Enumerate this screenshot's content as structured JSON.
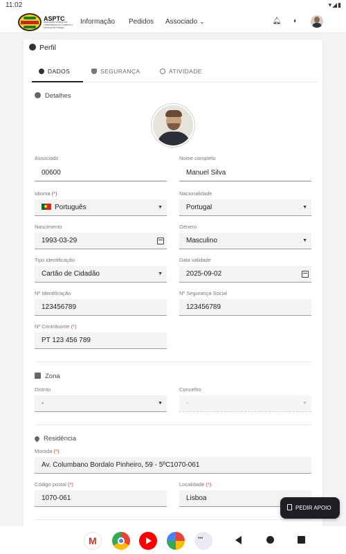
{
  "status_bar": {
    "time": "11:02"
  },
  "app_bar": {
    "brand": {
      "name": "ASPTC",
      "subtitle": "Associação Sindical dos Trabalhadores do Comércio e Serviços de Portugal"
    },
    "nav": [
      {
        "label": "Informação"
      },
      {
        "label": "Pedidos"
      },
      {
        "label": "Associado"
      }
    ]
  },
  "card": {
    "title": "Perfil",
    "tabs": [
      {
        "label": "DADOS",
        "active": true
      },
      {
        "label": "SEGURANÇA",
        "active": false
      },
      {
        "label": "ATIVIDADE",
        "active": false
      }
    ],
    "sections": {
      "detalhes": "Detalhes",
      "zona": "Zona",
      "residencia": "Residência"
    },
    "fields": {
      "associado": {
        "label": "Associado",
        "value": "00600"
      },
      "nome": {
        "label": "Nome completo",
        "value": "Manuel Silva"
      },
      "idioma": {
        "label": "Idioma",
        "required": "(*)",
        "value": "Português"
      },
      "nacionalidade": {
        "label": "Nacionalidade",
        "value": "Portugal"
      },
      "nascimento": {
        "label": "Nascimento",
        "value": "1993-03-29"
      },
      "genero": {
        "label": "Género",
        "value": "Masculino"
      },
      "tipo_id": {
        "label": "Tipo identificação",
        "value": "Cartão de Cidadão"
      },
      "validade": {
        "label": "Data validade",
        "value": "2025-09-02"
      },
      "num_id": {
        "label": "Nº Identificação",
        "value": "123456789"
      },
      "seg_social": {
        "label": "Nº Segurança Social",
        "value": "123456789"
      },
      "contribuinte": {
        "label": "Nº Contribuinte",
        "required": "(*)",
        "value": "PT 123 456 789"
      },
      "distrito": {
        "label": "Distrito",
        "value": "-"
      },
      "concelho": {
        "label": "Concelho",
        "value": "-"
      },
      "morada": {
        "label": "Morada",
        "required": "(*)",
        "value": "Av. Columbano Bordalo Pinheiro, 59 - 5ºC1070-061"
      },
      "codigo_postal": {
        "label": "Código postal",
        "required": "(*)",
        "value": "1070-061"
      },
      "localidade": {
        "label": "Localidade",
        "required": "(*)",
        "value": "Lisboa"
      }
    }
  },
  "fab": {
    "label": "PEDIR APOIO"
  },
  "icons": {
    "bell": "bell-icon",
    "language": "language-icon",
    "calendar": "calendar-icon",
    "flag": "portugal-flag-icon"
  },
  "colors": {
    "required": "#d23b3b",
    "fab_bg": "#1d1f22",
    "field_bg": "#f3f3f3"
  }
}
